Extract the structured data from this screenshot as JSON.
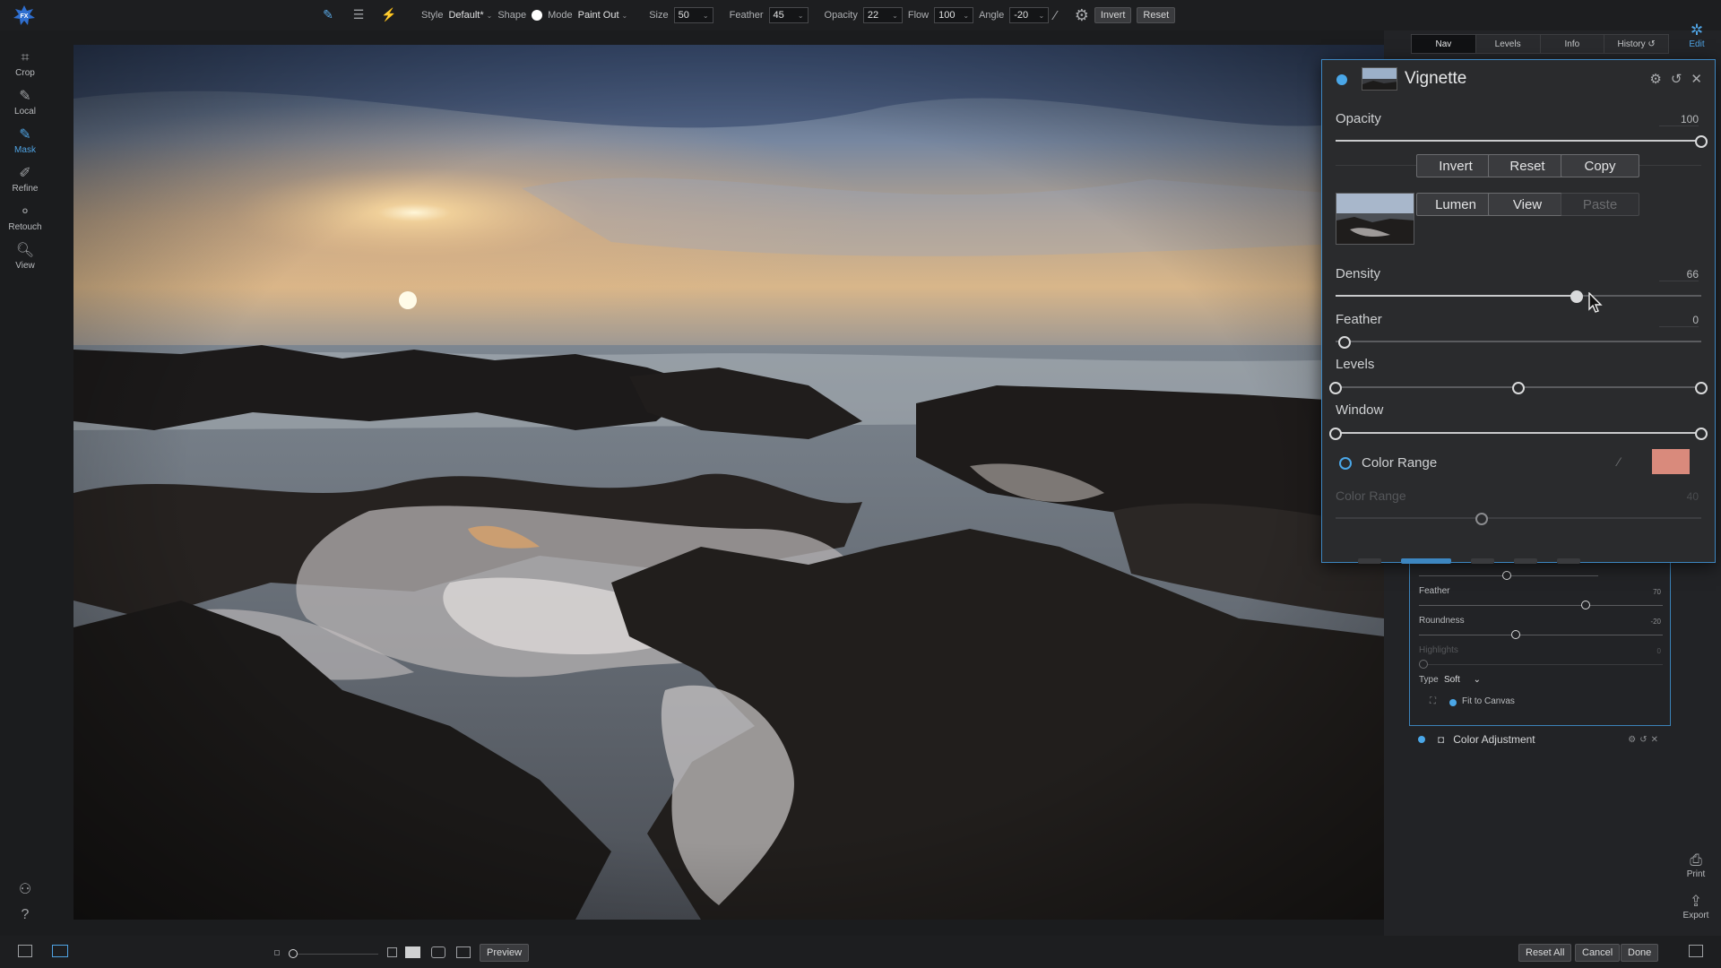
{
  "toolbar": {
    "style_label": "Style",
    "style_value": "Default*",
    "shape_label": "Shape",
    "mode_label": "Mode",
    "mode_value": "Paint Out",
    "size_label": "Size",
    "size_value": "50",
    "feather_label": "Feather",
    "feather_value": "45",
    "opacity_label": "Opacity",
    "opacity_value": "22",
    "flow_label": "Flow",
    "flow_value": "100",
    "angle_label": "Angle",
    "angle_value": "-20",
    "invert_label": "Invert",
    "reset_label": "Reset"
  },
  "left_tools": [
    {
      "label": "Crop",
      "icon": "crop-icon"
    },
    {
      "label": "Local",
      "icon": "local-brush-icon"
    },
    {
      "label": "Mask",
      "icon": "mask-brush-icon",
      "active": true
    },
    {
      "label": "Refine",
      "icon": "refine-brush-icon"
    },
    {
      "label": "Retouch",
      "icon": "retouch-icon"
    },
    {
      "label": "View",
      "icon": "view-zoom-icon"
    }
  ],
  "nav_tabs": [
    "Nav",
    "Levels",
    "Info",
    "History"
  ],
  "edit_label": "Edit",
  "print_label": "Print",
  "export_label": "Export",
  "vignette_panel": {
    "title": "Vignette",
    "opacity_label": "Opacity",
    "opacity_value": "100",
    "opacity_level": 1.0,
    "buttons": {
      "invert": "Invert",
      "reset": "Reset",
      "copy": "Copy",
      "lumen": "Lumen",
      "view": "View",
      "paste": "Paste"
    },
    "density_label": "Density",
    "density_value": "66",
    "density_level": 0.66,
    "feather_label": "Feather",
    "feather_value": "0",
    "levels_label": "Levels",
    "levels_handles": [
      0.0,
      0.5,
      1.0
    ],
    "window_label": "Window",
    "window_handles": [
      0.0,
      1.0
    ],
    "color_range_toggle_label": "Color Range",
    "color_range_swatch": "#d98a7c",
    "color_range_slider_label": "Color Range",
    "color_range_slider_value": "40",
    "color_range_level": 0.4
  },
  "under_panel": {
    "feather_label": "Feather",
    "feather_value": "70",
    "roundness_label": "Roundness",
    "roundness_value": "-20",
    "highlights_label": "Highlights",
    "highlights_value": "0",
    "type_label": "Type",
    "type_value": "Soft",
    "fit_to_canvas_label": "Fit to Canvas"
  },
  "layer_color_adjustment": "Color Adjustment",
  "bottom": {
    "preview_label": "Preview",
    "reset_all_label": "Reset All",
    "cancel_label": "Cancel",
    "done_label": "Done"
  },
  "colors": {
    "accent": "#4aa7e8",
    "panel_border": "#3d86c0"
  }
}
